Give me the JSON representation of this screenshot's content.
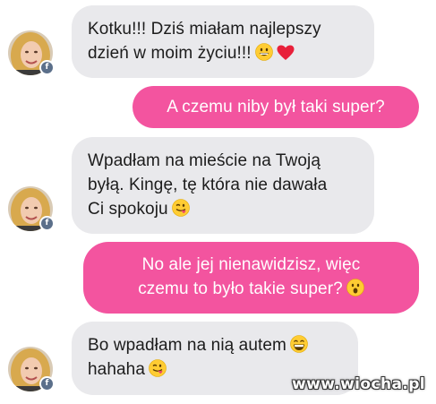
{
  "messages": [
    {
      "sender": "them",
      "lines": [
        "Kotku!!! Dziś miałam najlepszy",
        "dzień w moim życiu!!!"
      ],
      "emojis": [
        "grin-emoji",
        "heart-emoji"
      ]
    },
    {
      "sender": "me",
      "lines": [
        "A czemu niby był taki super?"
      ]
    },
    {
      "sender": "them",
      "lines": [
        "Wpadłam na mieście na Twoją",
        "byłą. Kingę, tę która nie dawała",
        "Ci spokoju"
      ],
      "emojis": [
        "tongue-emoji"
      ]
    },
    {
      "sender": "me",
      "lines": [
        "No ale jej nienawidzisz, więc",
        "czemu to było takie super?"
      ],
      "emojis": [
        "surprised-emoji"
      ]
    },
    {
      "sender": "them",
      "lines": [
        "Bo wpadłam na nią autem",
        "hahaha"
      ],
      "emojis": [
        "laughing-emoji",
        "tongue-emoji"
      ]
    }
  ],
  "watermark": "www.wiocha.pl",
  "colors": {
    "incoming_bubble": "#e9e9ec",
    "outgoing_bubble": "#f3549f",
    "incoming_text": "#1c1c1c",
    "outgoing_text": "#ffffff",
    "avatar_badge": "#5b6f8a"
  }
}
